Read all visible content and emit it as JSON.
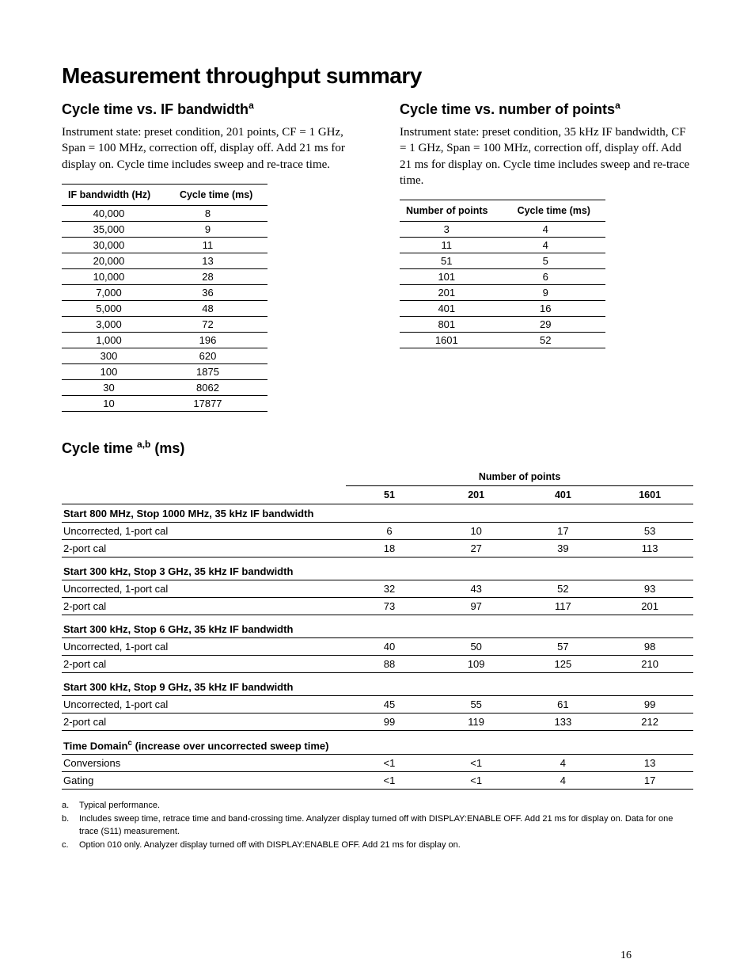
{
  "title": "Measurement throughput summary",
  "left": {
    "heading": "Cycle time vs. IF bandwidth",
    "heading_sup": "a",
    "desc": "Instrument state: preset condition, 201 points, CF = 1 GHz, Span = 100 MHz, correction off, display off. Add 21 ms for display on. Cycle time includes sweep and re-trace time.",
    "th1": "IF bandwidth (Hz)",
    "th2": "Cycle time (ms)",
    "rows": [
      [
        "40,000",
        "8"
      ],
      [
        "35,000",
        "9"
      ],
      [
        "30,000",
        "11"
      ],
      [
        "20,000",
        "13"
      ],
      [
        "10,000",
        "28"
      ],
      [
        "7,000",
        "36"
      ],
      [
        "5,000",
        "48"
      ],
      [
        "3,000",
        "72"
      ],
      [
        "1,000",
        "196"
      ],
      [
        "300",
        "620"
      ],
      [
        "100",
        "1875"
      ],
      [
        "30",
        "8062"
      ],
      [
        "10",
        "17877"
      ]
    ]
  },
  "right": {
    "heading": "Cycle time vs. number of points",
    "heading_sup": "a",
    "desc": "Instrument state: preset condition, 35 kHz IF bandwidth, CF = 1 GHz, Span = 100 MHz, correction off, display off. Add 21 ms for display on. Cycle time includes sweep and re-trace time.",
    "th1": "Number of points",
    "th2": "Cycle time (ms)",
    "rows": [
      [
        "3",
        "4"
      ],
      [
        "11",
        "4"
      ],
      [
        "51",
        "5"
      ],
      [
        "101",
        "6"
      ],
      [
        "201",
        "9"
      ],
      [
        "401",
        "16"
      ],
      [
        "801",
        "29"
      ],
      [
        "1601",
        "52"
      ]
    ]
  },
  "wide": {
    "heading": "Cycle time ",
    "heading_sup": "a,b",
    "heading_suffix": " (ms)",
    "span_label": "Number of points",
    "cols": [
      "51",
      "201",
      "401",
      "1601"
    ],
    "groups": [
      {
        "label": "Start 800 MHz, Stop 1000 MHz, 35 kHz IF bandwidth",
        "rows": [
          {
            "label": "Uncorrected, 1-port cal",
            "vals": [
              "6",
              "10",
              "17",
              "53"
            ]
          },
          {
            "label": "2-port cal",
            "vals": [
              "18",
              "27",
              "39",
              "113"
            ]
          }
        ]
      },
      {
        "label": "Start 300 kHz, Stop 3 GHz, 35 kHz IF bandwidth",
        "rows": [
          {
            "label": "Uncorrected, 1-port cal",
            "vals": [
              "32",
              "43",
              "52",
              "93"
            ]
          },
          {
            "label": "2-port cal",
            "vals": [
              "73",
              "97",
              "117",
              "201"
            ]
          }
        ]
      },
      {
        "label": "Start 300 kHz, Stop 6 GHz, 35 kHz IF bandwidth",
        "rows": [
          {
            "label": "Uncorrected, 1-port cal",
            "vals": [
              "40",
              "50",
              "57",
              "98"
            ]
          },
          {
            "label": "2-port cal",
            "vals": [
              "88",
              "109",
              "125",
              "210"
            ]
          }
        ]
      },
      {
        "label": "Start 300 kHz, Stop 9 GHz, 35 kHz IF bandwidth",
        "rows": [
          {
            "label": "Uncorrected, 1-port cal",
            "vals": [
              "45",
              "55",
              "61",
              "99"
            ]
          },
          {
            "label": "2-port cal",
            "vals": [
              "99",
              "119",
              "133",
              "212"
            ]
          }
        ]
      },
      {
        "label_pre": "Time Domain",
        "label_sup": "c",
        "label_post": " (increase over uncorrected sweep time)",
        "rows": [
          {
            "label": "Conversions",
            "vals": [
              "<1",
              "<1",
              "4",
              "13"
            ]
          },
          {
            "label": "Gating",
            "vals": [
              "<1",
              "<1",
              "4",
              "17"
            ]
          }
        ]
      }
    ]
  },
  "footnotes": [
    {
      "key": "a.",
      "text": "Typical performance."
    },
    {
      "key": "b.",
      "text": "Includes sweep time, retrace time and band-crossing time. Analyzer display turned off with DISPLAY:ENABLE OFF. Add 21 ms for display on. Data for one trace (S11) measurement."
    },
    {
      "key": "c.",
      "text": "Option 010 only. Analyzer display turned off with DISPLAY:ENABLE OFF. Add 21 ms for display on."
    }
  ],
  "page_number": "16"
}
